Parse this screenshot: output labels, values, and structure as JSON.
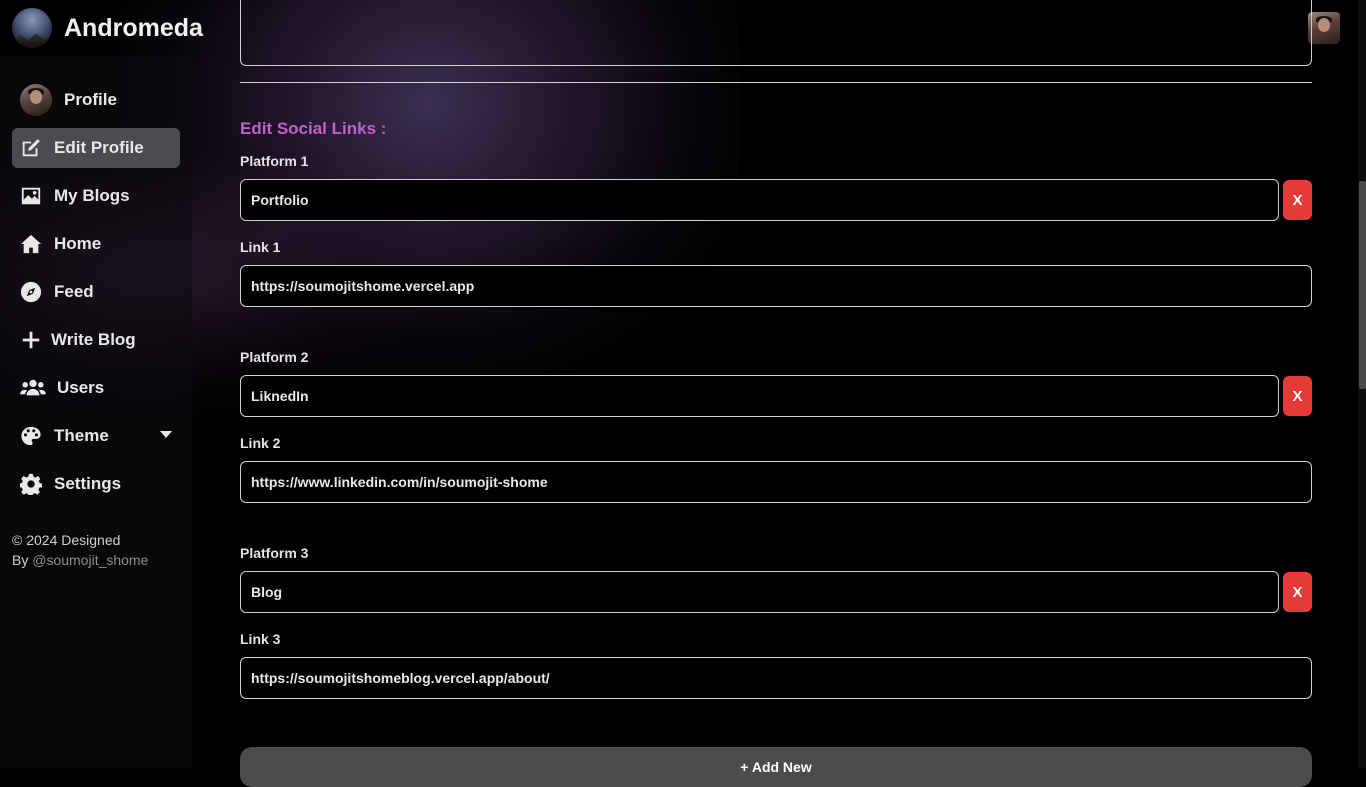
{
  "app": {
    "name": "Andromeda"
  },
  "sidebar": {
    "items": [
      {
        "label": "Profile",
        "icon": "profile-avatar"
      },
      {
        "label": "Edit Profile",
        "icon": "edit-icon",
        "active": true
      },
      {
        "label": "My Blogs",
        "icon": "image-icon"
      },
      {
        "label": "Home",
        "icon": "home-icon"
      },
      {
        "label": "Feed",
        "icon": "compass-icon"
      },
      {
        "label": "Write Blog",
        "icon": "plus-icon"
      },
      {
        "label": "Users",
        "icon": "users-icon"
      },
      {
        "label": "Theme",
        "icon": "palette-icon"
      },
      {
        "label": "Settings",
        "icon": "gear-icon"
      }
    ],
    "footer": {
      "line1": "© 2024 Designed",
      "by": "By ",
      "handle": "@soumojit_shome"
    }
  },
  "social": {
    "title": "Edit Social Links :",
    "remove_label": "X",
    "platforms": [
      {
        "platform_label": "Platform 1",
        "platform": "Portfolio",
        "link_label": "Link 1",
        "link": "https://soumojitshome.vercel.app"
      },
      {
        "platform_label": "Platform 2",
        "platform": "LiknedIn",
        "link_label": "Link 2",
        "link": "https://www.linkedin.com/in/soumojit-shome"
      },
      {
        "platform_label": "Platform 3",
        "platform": "Blog",
        "link_label": "Link 3",
        "link": "https://soumojitshomeblog.vercel.app/about/"
      }
    ],
    "add_label": "+ Add New"
  },
  "colors": {
    "accent": "#c45fcf",
    "danger": "#e53b36",
    "active_nav": "#4a4a4f"
  }
}
